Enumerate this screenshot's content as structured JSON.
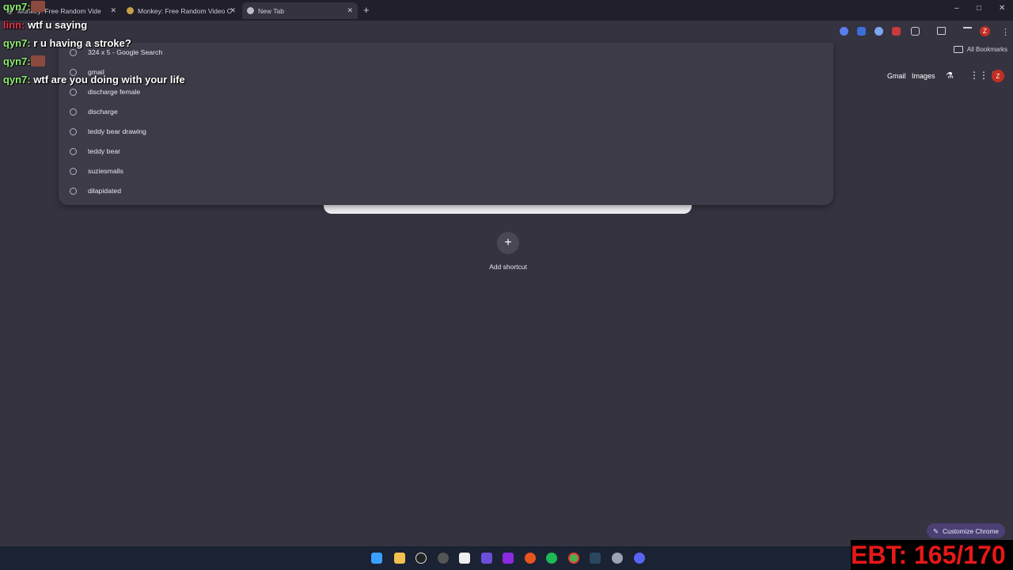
{
  "tabs": [
    {
      "label": "Monkey: Free Random Vide"
    },
    {
      "label": "Monkey: Free Random Video C"
    },
    {
      "label": "New Tab"
    }
  ],
  "new_tab_symbol": "+",
  "window_controls": {
    "minimize": "–",
    "maximize": "□",
    "close": "✕"
  },
  "bookmarks_bar": {
    "all_bookmarks": "All Bookmarks"
  },
  "google_header": {
    "gmail": "Gmail",
    "images": "Images",
    "profile_initial": "Z"
  },
  "suggestions": [
    "324 x 5 - Google Search",
    "gmail",
    "discharge female",
    "discharge",
    "teddy bear drawing",
    "teddy bear",
    "suziesmalls",
    "dilapidated"
  ],
  "add_shortcut": {
    "symbol": "+",
    "label": "Add shortcut"
  },
  "customize_chrome": {
    "label": "Customize Chrome",
    "icon": "pencil-icon"
  },
  "chat": [
    {
      "user": "qyn7:",
      "message": ""
    },
    {
      "user": "linn:",
      "message": "wtf u saying"
    },
    {
      "user": "qyn7:",
      "message": "r u having a stroke?"
    },
    {
      "user": "qyn7:",
      "message": ""
    },
    {
      "user": "qyn7:",
      "message": "wtf are you doing with your life"
    }
  ],
  "ebt_counter": "EBT: 165/170",
  "colors": {
    "page_bg": "#35333f",
    "tabbar_bg": "#211f2a",
    "taskbar_bg": "#1b2233",
    "chat_user": "#8cf06f",
    "ebt": "#e81818"
  }
}
